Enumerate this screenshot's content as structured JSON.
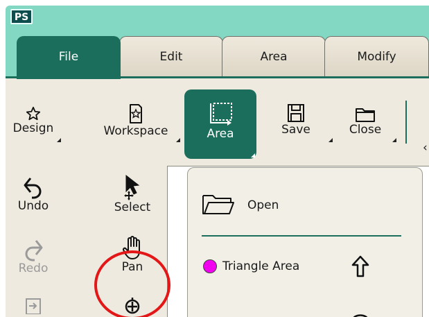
{
  "app": {
    "logo_text": "PS"
  },
  "tabs": [
    {
      "label": "File",
      "active": true
    },
    {
      "label": "Edit",
      "active": false
    },
    {
      "label": "Area",
      "active": false
    },
    {
      "label": "Modify",
      "active": false
    }
  ],
  "toolbar": {
    "design": {
      "label": "Design",
      "icon": "star-icon"
    },
    "workspace": {
      "label": "Workspace",
      "icon": "workspace-icon"
    },
    "area": {
      "label": "Area",
      "icon": "area-select-icon",
      "active": true
    },
    "save": {
      "label": "Save",
      "icon": "floppy-disk-icon"
    },
    "close": {
      "label": "Close",
      "icon": "folder-icon"
    }
  },
  "tools": {
    "undo": {
      "label": "Undo",
      "icon": "undo-icon"
    },
    "select": {
      "label": "Select",
      "icon": "select-arrow-icon",
      "highlighted": true
    },
    "redo": {
      "label": "Redo",
      "icon": "redo-icon",
      "disabled": true
    },
    "pan": {
      "label": "Pan",
      "icon": "hand-icon"
    }
  },
  "dropdown": {
    "open": {
      "label": "Open",
      "icon": "folder-open-icon"
    },
    "triangle_area": {
      "label": "Triangle Area",
      "dot_color": "#f100f0"
    }
  },
  "colors": {
    "accent": "#1c6e5c",
    "titlebar": "#83d8c4",
    "ribbon": "#eeeadf",
    "highlight": "#e31717"
  }
}
